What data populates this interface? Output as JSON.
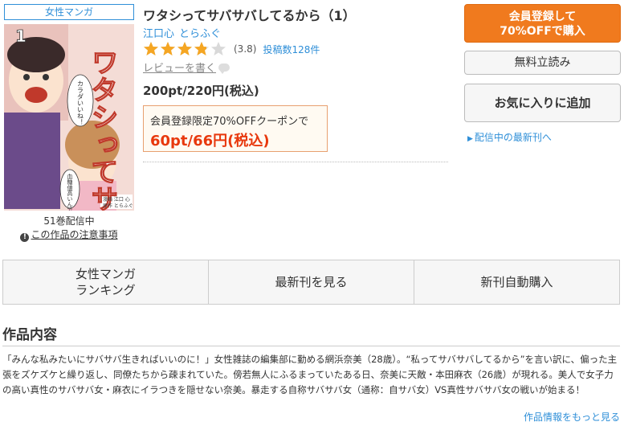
{
  "genre_badge": "女性マンガ",
  "title": "ワタシってサバサバしてるから（1）",
  "authors": [
    "江口心",
    "とらふぐ"
  ],
  "rating": {
    "score_text": "(3.8)",
    "value": 3.8,
    "max": 5,
    "posts_text": "投稿数128件"
  },
  "write_review": "レビューを書く",
  "price": "200pt/220円(税込)",
  "coupon": {
    "text": "会員登録限定70%OFFクーポンで",
    "price": "60pt/66円(税込)"
  },
  "cover": {
    "title_chars": "ワタシってサバサバしてるから",
    "volume_number": "1",
    "credit_art": "漫画 江口 心",
    "credit_story": "原作 とらふぐ",
    "bubble1": "カラダいいね！",
    "bubble2": "血糖値高いんですか？"
  },
  "volumes_text": "51巻配信中",
  "caution": {
    "icon": "!",
    "label": "この作品の注意事項"
  },
  "buttons": {
    "register_line1": "会員登録して",
    "register_line2": "70%OFFで購入",
    "sample": "無料立読み",
    "favorite": "お気に入りに追加"
  },
  "latest_link": "配信中の最新刊へ",
  "tabs": [
    {
      "line1": "女性マンガ",
      "line2": "ランキング"
    },
    {
      "line1": "最新刊を見る",
      "line2": ""
    },
    {
      "line1": "新刊自動購入",
      "line2": ""
    }
  ],
  "section_title": "作品内容",
  "description": "「みんな私みたいにサバサバ生きればいいのに！」女性雑誌の編集部に勤める網浜奈美（28歳）。“私ってサバサバしてるから”を言い訳に、偏った主張をズケズケと繰り返し、同僚たちから疎まれていた。傍若無人にふるまっていたある日、奈美に天敵・本田麻衣（26歳）が現れる。美人で女子力の高い真性のサバサバ女・麻衣にイラつきを隠せない奈美。暴走する自称サバサバ女（通称：自サバ女）VS真性サバサバ女の戦いが始まる！",
  "more_link": "作品情報をもっと見る",
  "colors": {
    "accent": "#2f8fd8",
    "orange": "#f07a1e",
    "coupon_red": "#e8380d",
    "star": "#f5a623"
  }
}
